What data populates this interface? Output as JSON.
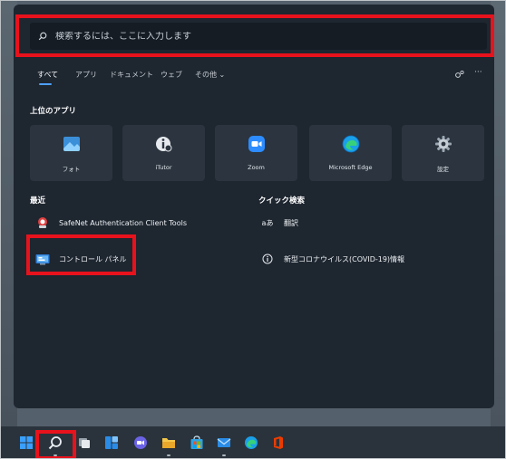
{
  "search": {
    "placeholder": "検索するには、ここに入力します"
  },
  "tabs": [
    {
      "label": "すべて",
      "active": true
    },
    {
      "label": "アプリ"
    },
    {
      "label": "ドキュメント"
    },
    {
      "label": "ウェブ"
    },
    {
      "label": "その他 ⌄"
    }
  ],
  "tab_icons": {
    "account": "account-switch-icon",
    "more": "···"
  },
  "top_apps": {
    "title": "上位のアプリ",
    "items": [
      {
        "label": "フォト",
        "icon": "photos-icon"
      },
      {
        "label": "iTutor",
        "icon": "itutor-icon"
      },
      {
        "label": "Zoom",
        "icon": "zoom-icon"
      },
      {
        "label": "Microsoft Edge",
        "icon": "edge-icon"
      },
      {
        "label": "設定",
        "icon": "settings-gear-icon"
      }
    ]
  },
  "recent": {
    "title": "最近",
    "items": [
      {
        "label": "SafeNet Authentication Client Tools",
        "icon": "safenet-icon"
      },
      {
        "label": "コントロール パネル",
        "icon": "control-panel-icon"
      }
    ]
  },
  "quick_search": {
    "title": "クイック検索",
    "items": [
      {
        "label": "翻訳",
        "icon_text": "aあ"
      },
      {
        "label": "新型コロナウイルス(COVID-19)情報",
        "icon": "info-icon"
      }
    ]
  },
  "taskbar": {
    "icons": [
      "start-icon",
      "search-icon",
      "task-view-icon",
      "widgets-icon",
      "chat-icon",
      "file-explorer-icon",
      "store-icon",
      "mail-icon",
      "edge-icon",
      "office-icon"
    ]
  },
  "colors": {
    "accent": "#4ea1ff",
    "highlight": "#e8121c",
    "panel": "#1e2630",
    "tile": "#2b343f"
  }
}
